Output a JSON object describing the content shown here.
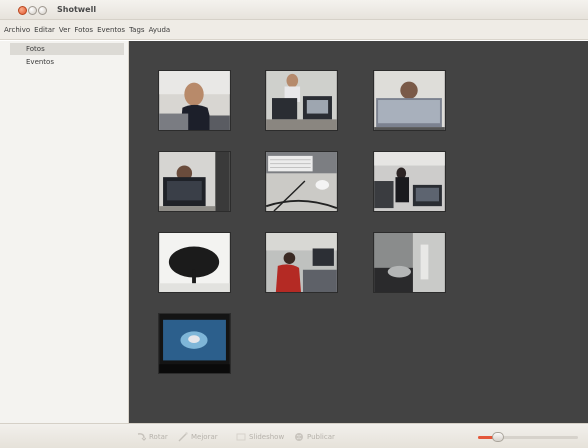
{
  "window": {
    "title": "Shotwell"
  },
  "menubar": {
    "items": [
      {
        "label": "Archivo"
      },
      {
        "label": "Editar"
      },
      {
        "label": "Ver"
      },
      {
        "label": "Fotos"
      },
      {
        "label": "Eventos"
      },
      {
        "label": "Tags"
      },
      {
        "label": "Ayuda"
      }
    ]
  },
  "sidebar": {
    "items": [
      {
        "label": "Fotos",
        "selected": true
      },
      {
        "label": "Eventos",
        "selected": false
      }
    ]
  },
  "viewer": {
    "background": "#434343",
    "photos": [
      {
        "icon": "photo-person-laptop"
      },
      {
        "icon": "photo-office-computers"
      },
      {
        "icon": "photo-person-behind-monitor"
      },
      {
        "icon": "photo-person-at-monitor"
      },
      {
        "icon": "photo-keyboard-mouse"
      },
      {
        "icon": "photo-monitors-room"
      },
      {
        "icon": "photo-tree"
      },
      {
        "icon": "photo-classroom"
      },
      {
        "icon": "photo-blurred-room"
      },
      {
        "icon": "photo-tv-screen"
      }
    ]
  },
  "toolbar": {
    "rotate_label": "Rotar",
    "enhance_label": "Mejorar",
    "slideshow_label": "Slideshow",
    "publish_label": "Publicar",
    "zoom_level": 0.18,
    "accent": "#e4573a"
  }
}
